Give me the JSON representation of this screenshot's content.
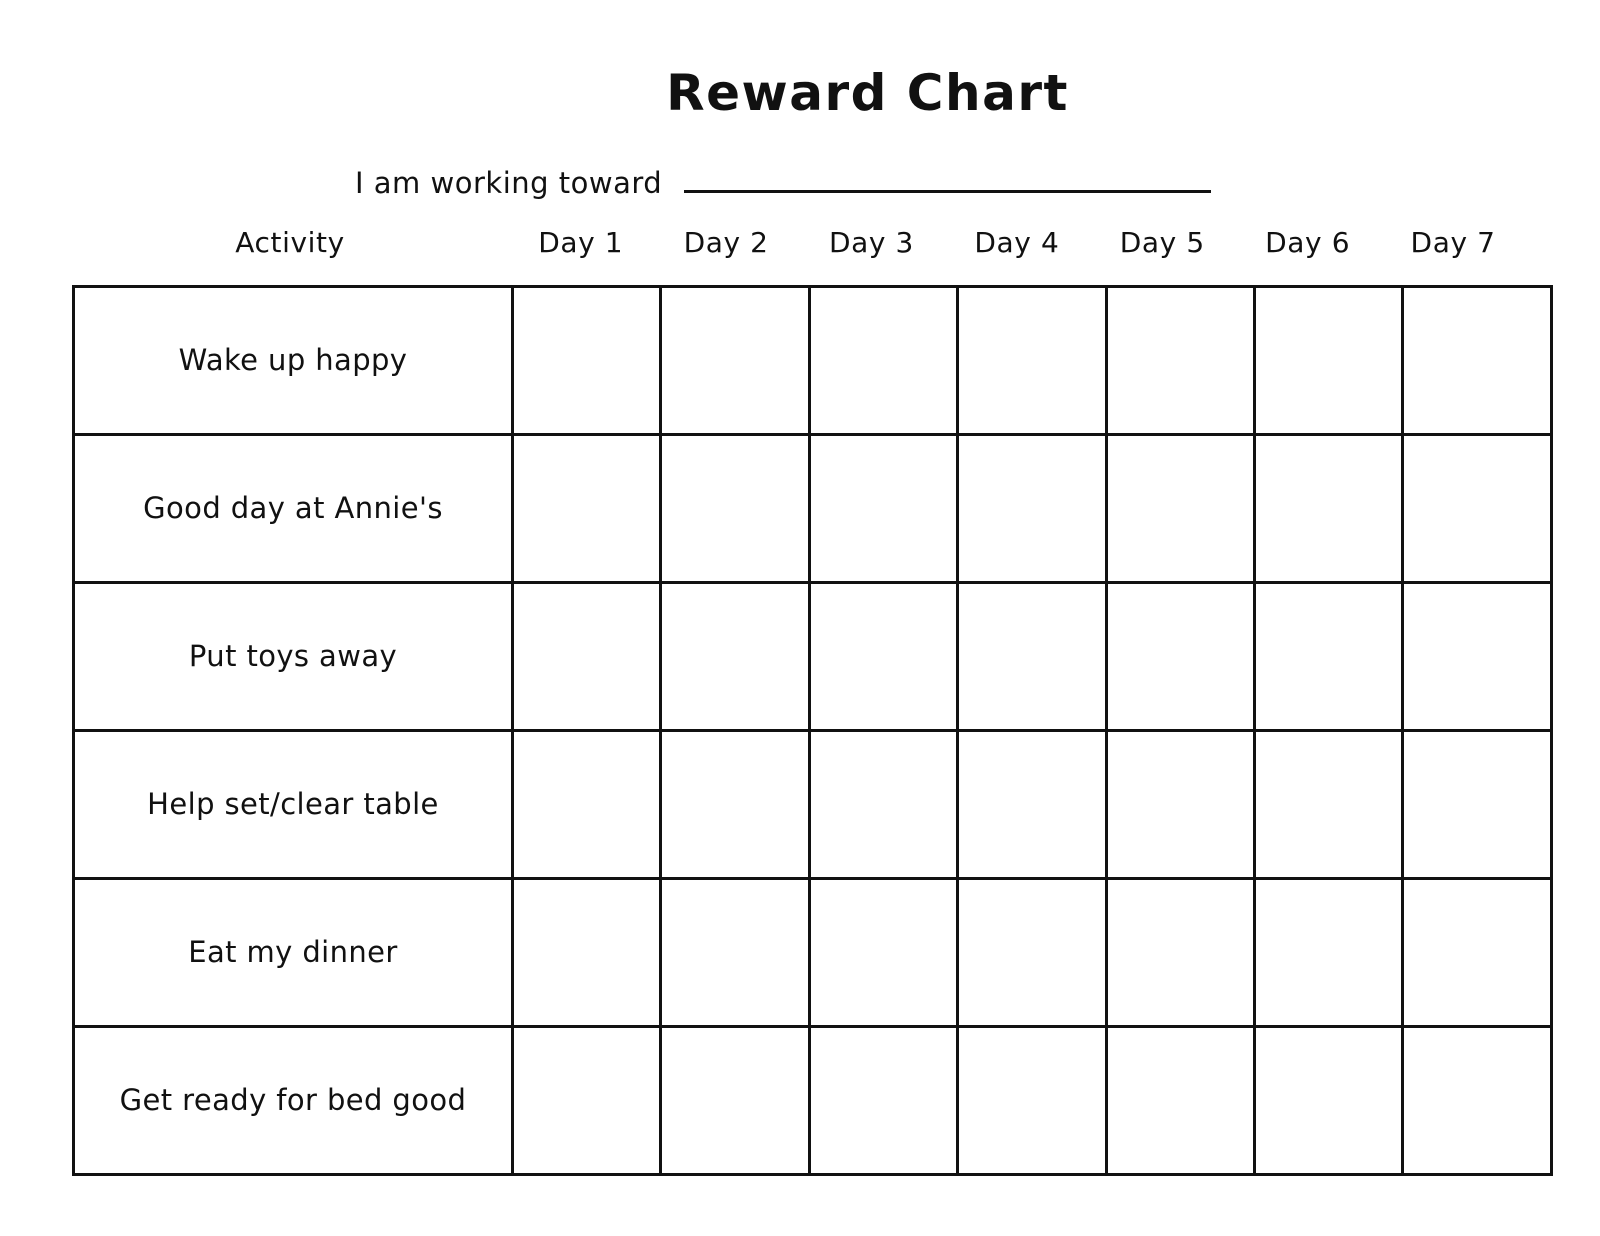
{
  "document": {
    "title": "Reward Chart"
  },
  "goal": {
    "label": "I am working toward",
    "value": "",
    "placeholder": ""
  },
  "table": {
    "activity_header": "Activity",
    "day_headers": [
      "Day 1",
      "Day 2",
      "Day 3",
      "Day 4",
      "Day 5",
      "Day 6",
      "Day 7"
    ],
    "activities": [
      "Wake up happy",
      "Good day at Annie's",
      "Put toys away",
      "Help set/clear table",
      "Eat my dinner",
      "Get ready for bed good"
    ],
    "marks": [
      [
        "",
        "",
        "",
        "",
        "",
        "",
        ""
      ],
      [
        "",
        "",
        "",
        "",
        "",
        "",
        ""
      ],
      [
        "",
        "",
        "",
        "",
        "",
        "",
        ""
      ],
      [
        "",
        "",
        "",
        "",
        "",
        "",
        ""
      ],
      [
        "",
        "",
        "",
        "",
        "",
        "",
        ""
      ],
      [
        "",
        "",
        "",
        "",
        "",
        "",
        ""
      ]
    ]
  },
  "colors": {
    "ink": "#111111",
    "paper": "#ffffff"
  }
}
